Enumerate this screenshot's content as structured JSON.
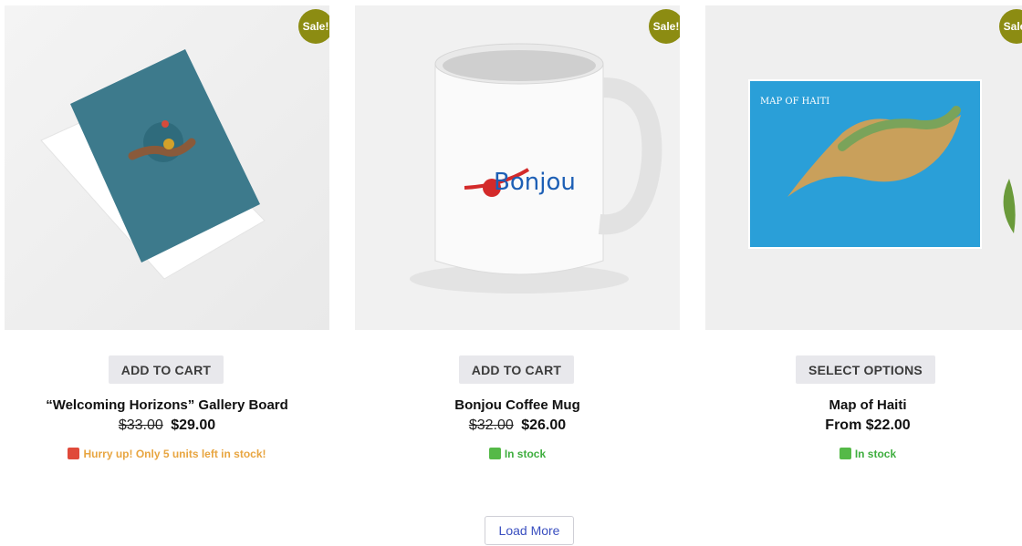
{
  "products": [
    {
      "badge": "Sale!",
      "button_label": "ADD TO CART",
      "title": "“Welcoming Horizons” Gallery Board",
      "price_old": "$33.00",
      "price_new": "$29.00",
      "stock_text": "Hurry up! Only 5 units left in stock!",
      "stock_icon": "siren-icon",
      "image_icon": "gallery-board-image"
    },
    {
      "badge": "Sale!",
      "button_label": "ADD TO CART",
      "title": "Bonjou Coffee Mug",
      "price_old": "$32.00",
      "price_new": "$26.00",
      "stock_text": "In stock",
      "stock_icon": "check-icon",
      "image_icon": "coffee-mug-image",
      "mug_text": "Bonjou"
    },
    {
      "badge": "Sale!",
      "button_label": "SELECT OPTIONS",
      "title": "Map of Haiti",
      "price_from": "From $22.00",
      "stock_text": "In stock",
      "stock_icon": "check-icon",
      "image_icon": "map-print-image",
      "map_caption": "MAP OF HAITI"
    }
  ],
  "load_more_label": "Load More",
  "colors": {
    "sale_badge": "#8c8c12",
    "warn_text": "#e8a540",
    "ok_text": "#3fae3f",
    "load_more_text": "#3a4fc0"
  }
}
